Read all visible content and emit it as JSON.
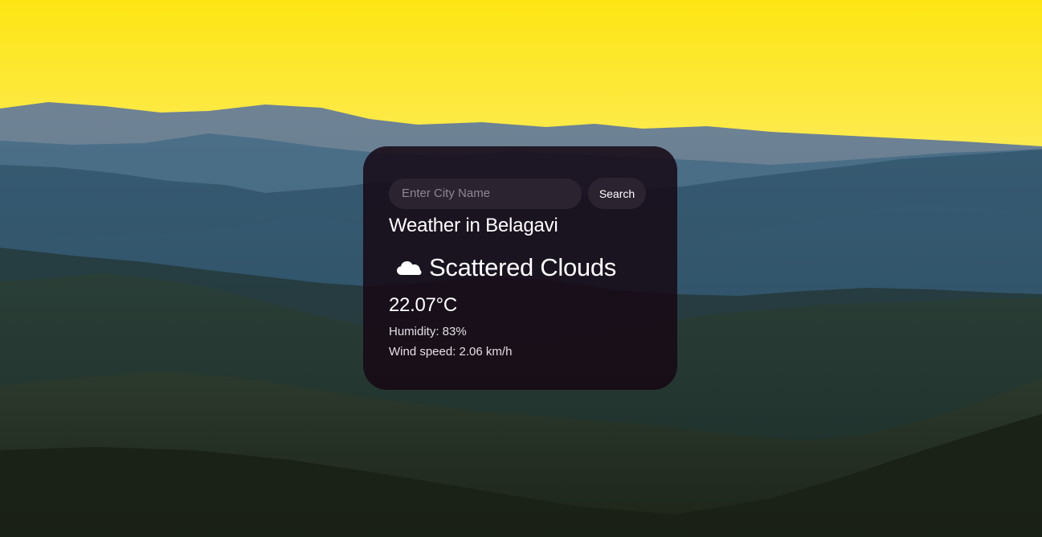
{
  "search": {
    "placeholder": "Enter City Name",
    "value": "",
    "button_label": "Search"
  },
  "weather": {
    "title": "Weather in Belagavi",
    "icon": "cloud-icon",
    "description": "Scattered Clouds",
    "temperature": "22.07°C",
    "humidity": "Humidity: 83%",
    "wind": "Wind speed: 2.06 km/h"
  },
  "colors": {
    "card_background": "#160814",
    "input_background": "#2c2330",
    "text": "#ffffff"
  }
}
